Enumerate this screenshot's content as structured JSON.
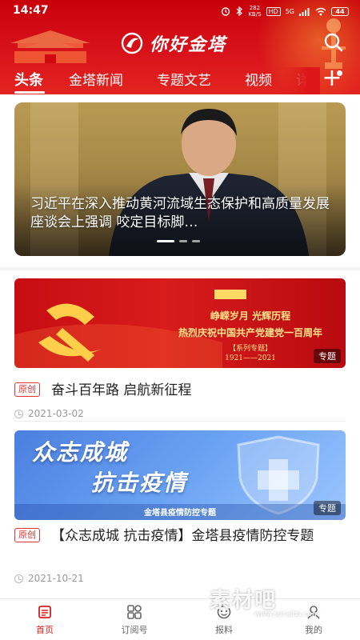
{
  "status_bar": {
    "time": "14:47",
    "network_speed": "282",
    "network_unit": "KB/S",
    "hd_label": "HD",
    "signal": "5G",
    "battery": "44"
  },
  "header": {
    "app_name": "你好金塔",
    "tabs": [
      {
        "label": "头条",
        "active": true
      },
      {
        "label": "金塔新闻",
        "active": false
      },
      {
        "label": "专题文艺",
        "active": false
      },
      {
        "label": "视频",
        "active": false
      },
      {
        "label": "详",
        "active": false
      }
    ],
    "add_tab_symbol": "+",
    "accent_color": "#d8121a"
  },
  "banner": {
    "title": "习近平在深入推动黄河流域生态保护和高质量发展座谈会上强调  咬定目标脚…",
    "slide_count": 3,
    "active_slide": 0
  },
  "articles": [
    {
      "image_lines": [
        "峥嵘岁月  光辉历程",
        "热烈庆祝中国共产党建党一百周年",
        "【系列专题】",
        "1921——2021"
      ],
      "topic_badge": "专题",
      "original_badge": "原创",
      "title": "奋斗百年路   启航新征程",
      "date": "2021-03-02"
    },
    {
      "image_lines": [
        "众志成城",
        "抗击疫情",
        "金塔县疫情防控专题"
      ],
      "topic_badge": "专题",
      "original_badge": "原创",
      "title": "【众志成城   抗击疫情】金塔县疫情防控专题",
      "date": "2021-10-21"
    }
  ],
  "bottom_nav": [
    {
      "label": "首页",
      "icon": "home-icon",
      "active": true
    },
    {
      "label": "订阅号",
      "icon": "subscribe-icon",
      "active": false
    },
    {
      "label": "报料",
      "icon": "report-icon",
      "active": false
    },
    {
      "label": "我的",
      "icon": "profile-icon",
      "active": false
    }
  ],
  "watermark": {
    "text": "素材吧",
    "url_text": "www.sucaiba.com"
  }
}
